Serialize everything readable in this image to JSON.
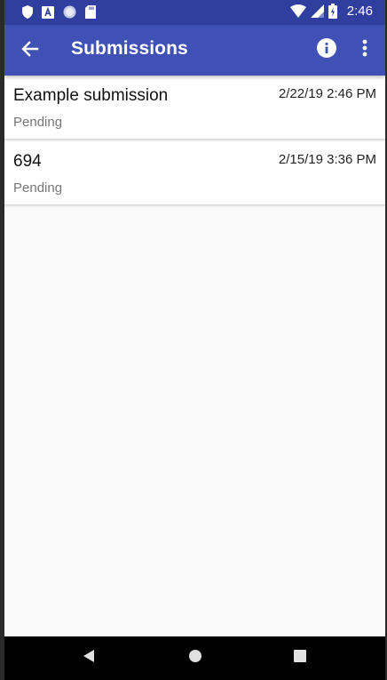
{
  "status_bar": {
    "time": "2:46",
    "left_icons": [
      "shield-icon",
      "a-badge-icon",
      "circle-icon",
      "sd-card-icon"
    ],
    "right_icons": [
      "wifi-icon",
      "signal-icon",
      "battery-icon"
    ]
  },
  "app_bar": {
    "title": "Submissions",
    "back_icon": "arrow-back-icon",
    "info_icon": "info-icon",
    "more_icon": "more-vert-icon",
    "color": "#3f51b5",
    "status_color": "#303f9f"
  },
  "submissions": [
    {
      "title": "Example submission",
      "date": "2/22/19 2:46 PM",
      "status": "Pending"
    },
    {
      "title": "694",
      "date": "2/15/19 3:36 PM",
      "status": "Pending"
    }
  ],
  "nav_bar": {
    "icons": [
      "nav-back-icon",
      "nav-home-icon",
      "nav-recents-icon"
    ]
  }
}
